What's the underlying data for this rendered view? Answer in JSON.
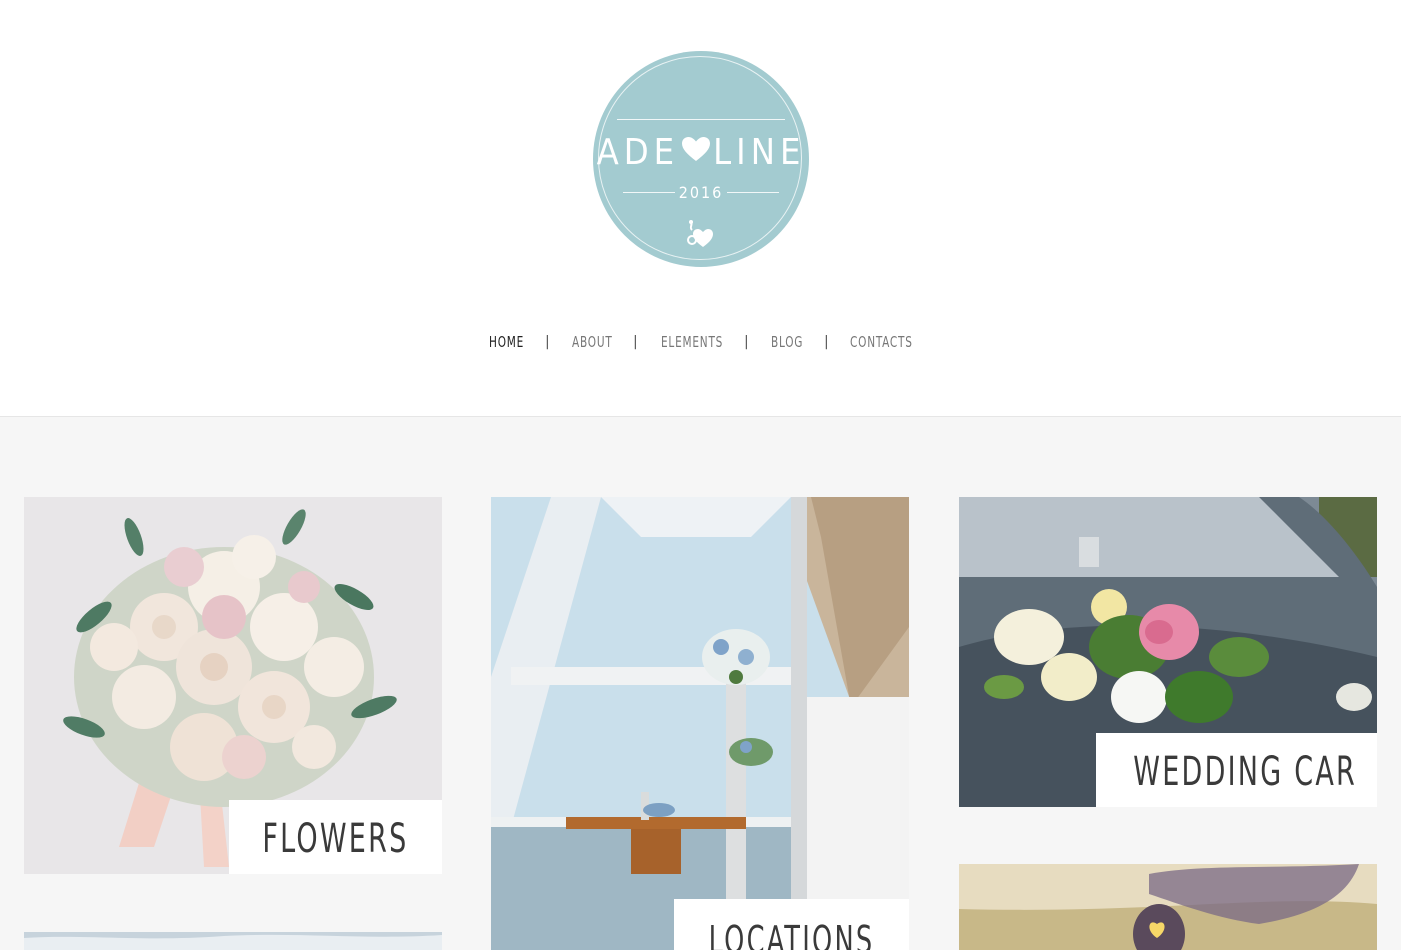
{
  "logo": {
    "left": "ADE",
    "right": "LINE",
    "year": "2016"
  },
  "nav": {
    "items": [
      {
        "label": "HOME"
      },
      {
        "label": "ABOUT"
      },
      {
        "label": "ELEMENTS"
      },
      {
        "label": "BLOG"
      },
      {
        "label": "CONTACTS"
      }
    ],
    "separator": "|"
  },
  "cards": {
    "flowers": {
      "label": "FLOWERS"
    },
    "locations": {
      "label": "LOCATIONS"
    },
    "wedding_car": {
      "label": "WEDDING CAR"
    }
  },
  "colors": {
    "logo_bg": "#a3cbd0",
    "page_bg": "#f6f6f6",
    "nav_active": "#222222",
    "nav_text": "#777777"
  }
}
